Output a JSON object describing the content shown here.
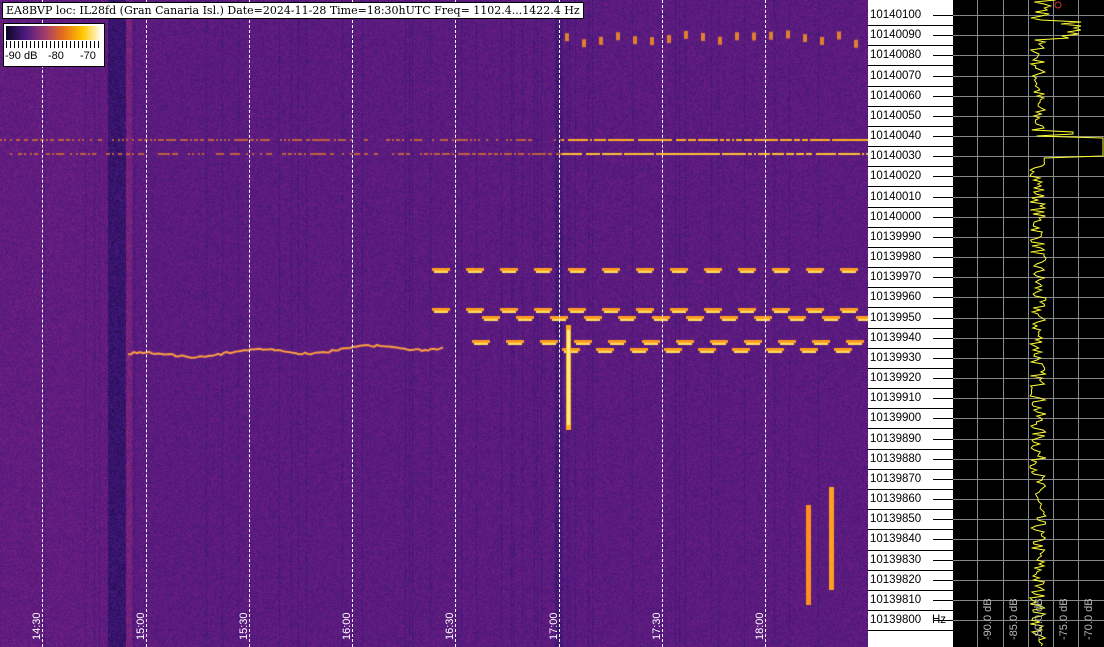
{
  "header": {
    "title": "EA8BVP loc: IL28fd (Gran Canaria Isl.) Date=2024-11-28 Time=18:30hUTC Freq= 1102.4...1422.4 Hz"
  },
  "legend": {
    "labels": [
      "-90 dB",
      "-80",
      "-70"
    ]
  },
  "time_axis": {
    "labels": [
      "14:30",
      "15:00",
      "15:30",
      "16:00",
      "16:30",
      "17:00",
      "17:30",
      "18:00"
    ]
  },
  "freq_axis": {
    "labels": [
      "10140100",
      "10140090",
      "10140080",
      "10140070",
      "10140060",
      "10140050",
      "10140040",
      "10140030",
      "10140020",
      "10140010",
      "10140000",
      "10139990",
      "10139980",
      "10139970",
      "10139960",
      "10139950",
      "10139940",
      "10139930",
      "10139920",
      "10139910",
      "10139900",
      "10139890",
      "10139880",
      "10139870",
      "10139860",
      "10139850",
      "10139840",
      "10139830",
      "10139820",
      "10139810",
      "10139800"
    ],
    "unit": "Hz"
  },
  "spectrum_panel": {
    "db_labels": [
      "-90.0 dB",
      "-85.0 dB",
      "-80.0 dB",
      "-75.0 dB",
      "-70.0 dB"
    ],
    "trace_color": "#ffff33",
    "grid_color": "#888888"
  }
}
